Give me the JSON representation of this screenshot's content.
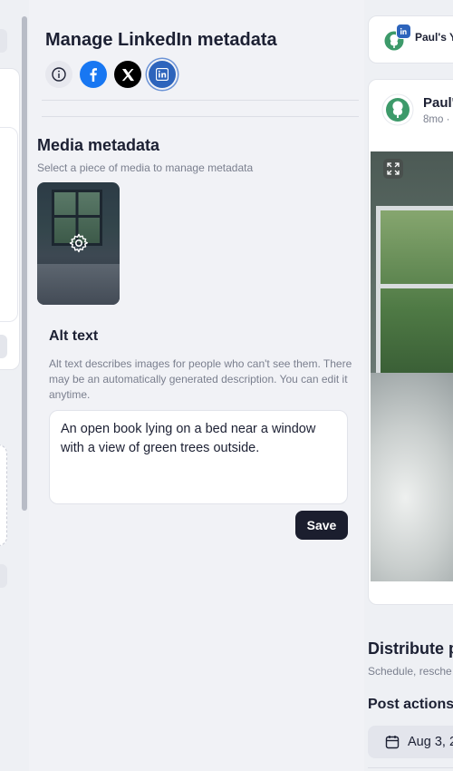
{
  "panel": {
    "title": "Manage LinkedIn metadata",
    "platform_icons": [
      "info-icon",
      "facebook-icon",
      "x-icon",
      "linkedin-icon"
    ],
    "selected_platform": "linkedin"
  },
  "media": {
    "title": "Media metadata",
    "subtitle": "Select a piece of media to manage metadata"
  },
  "alt_text": {
    "title": "Alt text",
    "help": "Alt text describes images for people who can't see them. There may be an automatically generated description. You can edit it anytime.",
    "value": "An open book lying on a bed near a window with a view of green trees outside.",
    "save_label": "Save"
  },
  "preview": {
    "account_name": "Paul's Yo",
    "post_author": "Paul'",
    "post_meta": "8mo ·",
    "distribute_title": "Distribute p",
    "distribute_sub": "Schedule, resche",
    "post_actions_title": "Post actions",
    "date_label": "Aug 3, 2"
  },
  "colors": {
    "brand_green": "#3d9a6a",
    "linkedin_blue": "#2d64bc",
    "facebook_blue": "#1877f2",
    "save_button_bg": "#1b1e2e"
  }
}
